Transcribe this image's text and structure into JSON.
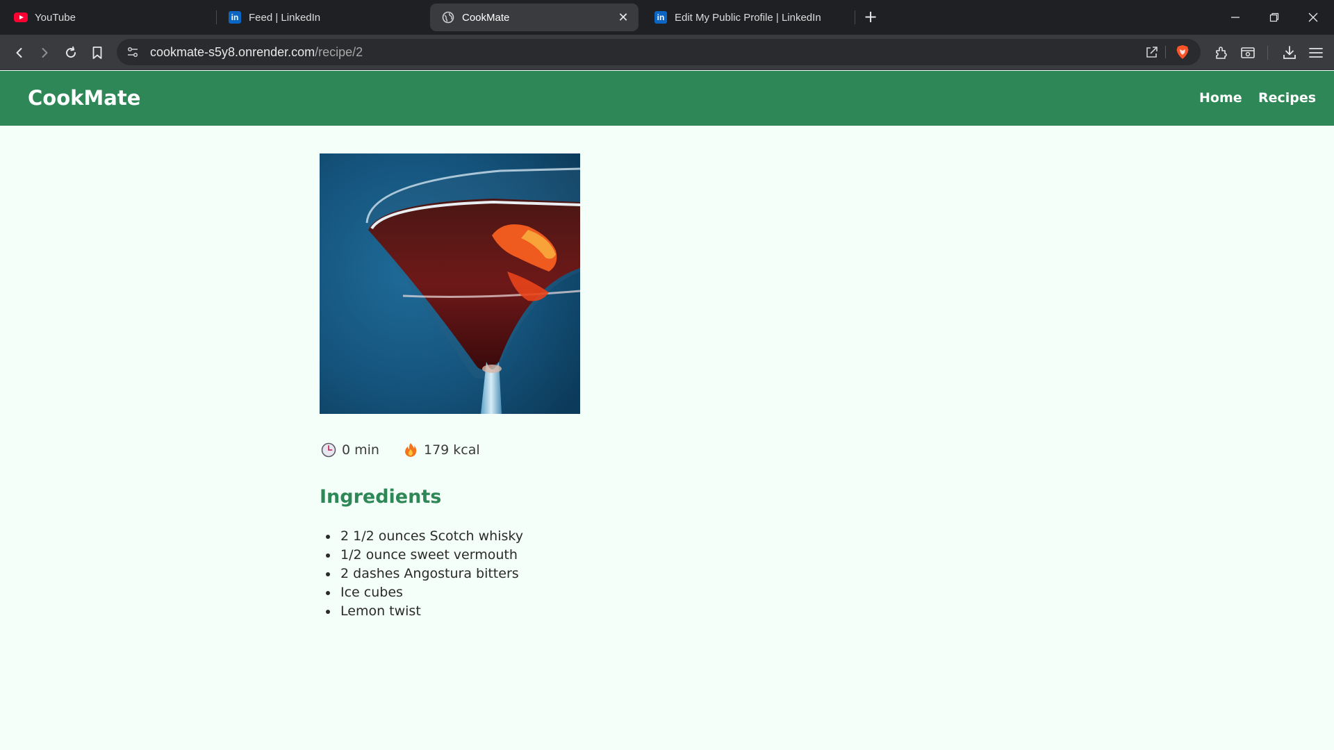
{
  "browser": {
    "tabs": [
      {
        "title": "YouTube",
        "favicon": "youtube-icon"
      },
      {
        "title": "Feed | LinkedIn",
        "favicon": "linkedin-icon"
      },
      {
        "title": "CookMate",
        "favicon": "globe-icon",
        "active": true
      },
      {
        "title": "Edit My Public Profile | LinkedIn",
        "favicon": "linkedin-icon"
      }
    ],
    "url_host": "cookmate-s5y8.onrender.com",
    "url_path": "/recipe/2"
  },
  "navbar": {
    "brand": "CookMate",
    "links": [
      "Home",
      "Recipes"
    ],
    "color": "#2e8757"
  },
  "recipe": {
    "image_alt": "Cocktail in a coupe glass with an orange twist on a blue background",
    "time": "0 min",
    "calories": "179 kcal",
    "ingredients_heading": "Ingredients",
    "ingredients": [
      "2 1/2 ounces Scotch whisky",
      "1/2 ounce sweet vermouth",
      "2 dashes Angostura bitters",
      "Ice cubes",
      "Lemon twist"
    ]
  },
  "colors": {
    "accent": "#2e8757",
    "page_background": "#f5fff9",
    "tab_bar": "#1f2023",
    "toolbar": "#3a3b3f"
  }
}
